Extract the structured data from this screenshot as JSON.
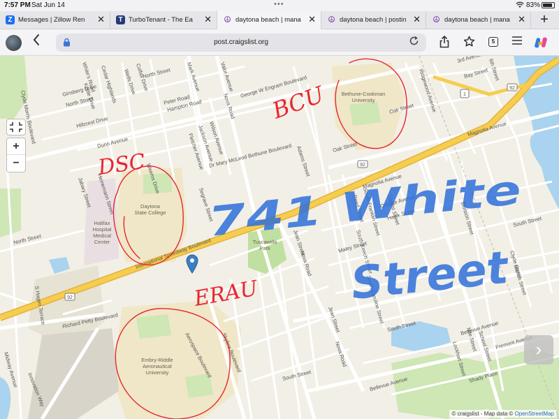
{
  "status_bar": {
    "time": "7:57 PM",
    "date": "Sat Jun 14",
    "battery": "83%"
  },
  "tabs": [
    {
      "title": "Messages | Zillow Ren",
      "icon": "zillow-icon",
      "color": "#1b6ef3",
      "active": false
    },
    {
      "title": "TurboTenant - The Ea",
      "icon": "turbotenant-icon",
      "color": "#243b7a",
      "active": false
    },
    {
      "title": "daytona beach | mana",
      "icon": "craigslist-peace-icon",
      "color": "#7b2fa0",
      "active": true
    },
    {
      "title": "daytona beach | postin",
      "icon": "craigslist-peace-icon",
      "color": "#7b2fa0",
      "active": false
    },
    {
      "title": "daytona beach | mana",
      "icon": "craigslist-peace-icon",
      "color": "#7b2fa0",
      "active": false
    }
  ],
  "toolbar": {
    "url": "post.craigslist.org",
    "tab_count": "5"
  },
  "map": {
    "attribution_prefix": "© craigslist - Map data ©",
    "attribution_link": "OpenStreetMap",
    "zoom_in": "+",
    "zoom_out": "−",
    "next": "›",
    "places": {
      "daytona_state_college": [
        "Daytona",
        "State College"
      ],
      "halifax_hospital": [
        "Halifax",
        "Hospital",
        "Medical",
        "Center"
      ],
      "bethune_cookman": [
        "Bethune-Cookman",
        "University"
      ],
      "tuscawilla_park": [
        "Tuscawilla",
        "Park"
      ],
      "embry_riddle": [
        "Embry-Riddle",
        "Aeronautical",
        "University"
      ]
    },
    "roads": {
      "international_speedway": "International Speedway Boulevard",
      "dr_mary_mcleod": "Dr Mary McLeod Bethune Boulevard",
      "george_engram": "George W Engram Boulevard",
      "magnolia_ave": "Magnolia Avenue",
      "magnolia_ave_east": "Magnolia Avenue",
      "orange_ave": "Orange Avenue",
      "south_street": "South Street",
      "south_street_2": "South Street",
      "south_street_3": "South Street",
      "bellevue_ave": "Bellevue Avenue",
      "bellevue_ave_2": "Bellevue Avenue",
      "richard_petty": "Richard Petty Boulevard",
      "aerospace_blvd": "Aerospace Boulevard",
      "skyline_blvd": "Skyline Boulevard",
      "innovation_way": "Innovation Way",
      "midway_ave": "Midway Avenue",
      "clyde_morris": "Clyde Morris Boulevard",
      "north_street": "North Street",
      "north_street_2": "North Street",
      "hampton_road": "Hampton Road",
      "peter_road": "Peter Road",
      "dunn_avenue": "Dunn Avenue",
      "ginsberg_drive": "Ginsberg Drive",
      "hillcrest_drive": "Hillcrest Drive",
      "nova_road": "Nova Road",
      "nova_road_2": "Nova Road",
      "nova_road_3": "Nova Road",
      "jean_street": "Jean Street",
      "jean_street_2": "Jean Street",
      "adams_street": "Adams Street",
      "oak_street": "Oak Street",
      "oak_street_2": "Oak Street",
      "hawk_street": "Hawk Street",
      "maley_street": "Maley Street",
      "fremont_avenue": "Fremont Avenue",
      "bay_street": "Bay Street",
      "third_avenue": "3rd Avenue",
      "segrave_street": "Segrave Street",
      "ridgewood_avenue": "Ridgewood Avenue",
      "school_street": "School Street",
      "marion_street": "Marion Street",
      "clyde_street": "Clyde Street",
      "wilson_avenue": "Wilson Avenue",
      "jackson_avenue": "Jackson Avenue",
      "fletcher_avenue": "Fletcher Avenue",
      "sixth_street": "6th Street",
      "shady_place": "Shady Place",
      "hagen_terrace": "S Hagen Terrace",
      "reed_street": "Reed Street",
      "locust_street": "Locust Street",
      "south_franklin_street": "South Franklin Street",
      "south_keech_street": "South Keech Street",
      "south_caroline_street": "South Caroline Street",
      "nile_street": "Nile Street",
      "division_street": "Division Street",
      "lockhart_street": "Lockhart Street",
      "north_street_west": "North Street",
      "kottle_drive": "Kottle Drive",
      "heinemann_street": "Heinemann Street",
      "jabary_street": "Jabary Street",
      "weems_drive": "Weems Drive",
      "wells_drive": "Wells Drive",
      "valor_avenue": "Valor Avenue",
      "mark_avenue": "Mark Avenue",
      "colfax_drive": "Colfax Drive",
      "whites_road": "White's Road",
      "cedar_highlands": "Cedar Highlands"
    },
    "route_shields": [
      "92",
      "92",
      "92",
      "1"
    ],
    "annotations": {
      "dsc": "DSC",
      "bcu": "BCU",
      "erau": "ERAU",
      "address": "741 White Street"
    },
    "colors": {
      "background": "#f2efe6",
      "highway": "#f6cd4f",
      "water": "#a9d3ee",
      "green": "#cfe6b5",
      "campus": "#efe7c8",
      "ink_red": "#e8262f",
      "ink_blue": "#2e6fd8",
      "marker": "#3a7fc6"
    }
  }
}
